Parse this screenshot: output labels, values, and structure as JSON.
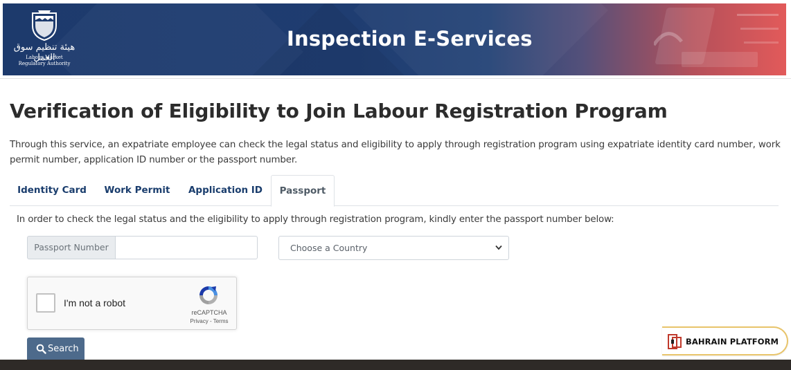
{
  "banner": {
    "logo_arabic": "هيئة تنظيم سوق العمل",
    "logo_english_line1": "Labour Market",
    "logo_english_line2": "Regulatory Authority",
    "title": "Inspection E-Services"
  },
  "page": {
    "title": "Verification of Eligibility to Join Labour Registration Program",
    "intro": "Through this service, an expatriate employee can check the legal status and eligibility to apply through registration program using expatriate identity card number, work permit number, application ID number or the passport number."
  },
  "tabs": [
    {
      "label": "Identity Card",
      "active": false
    },
    {
      "label": "Work Permit",
      "active": false
    },
    {
      "label": "Application ID",
      "active": false
    },
    {
      "label": "Passport",
      "active": true
    }
  ],
  "form": {
    "instruction": "In order to check the legal status and the eligibility to apply through registration program, kindly enter the passport number below:",
    "passport_label": "Passport Number",
    "passport_value": "",
    "country_selected": "Choose a Country"
  },
  "captcha": {
    "label": "I'm not a robot",
    "brand": "reCAPTCHA",
    "links": "Privacy - Terms"
  },
  "search_button": {
    "label": "Search"
  },
  "badge": {
    "label": "BAHRAIN PLATFORM"
  },
  "colors": {
    "banner_blue": "#1f3d71",
    "banner_red": "#e25a5a",
    "tab_text": "#1a3d6d",
    "button": "#4d6a8b",
    "badge_border": "#e8c46a"
  }
}
